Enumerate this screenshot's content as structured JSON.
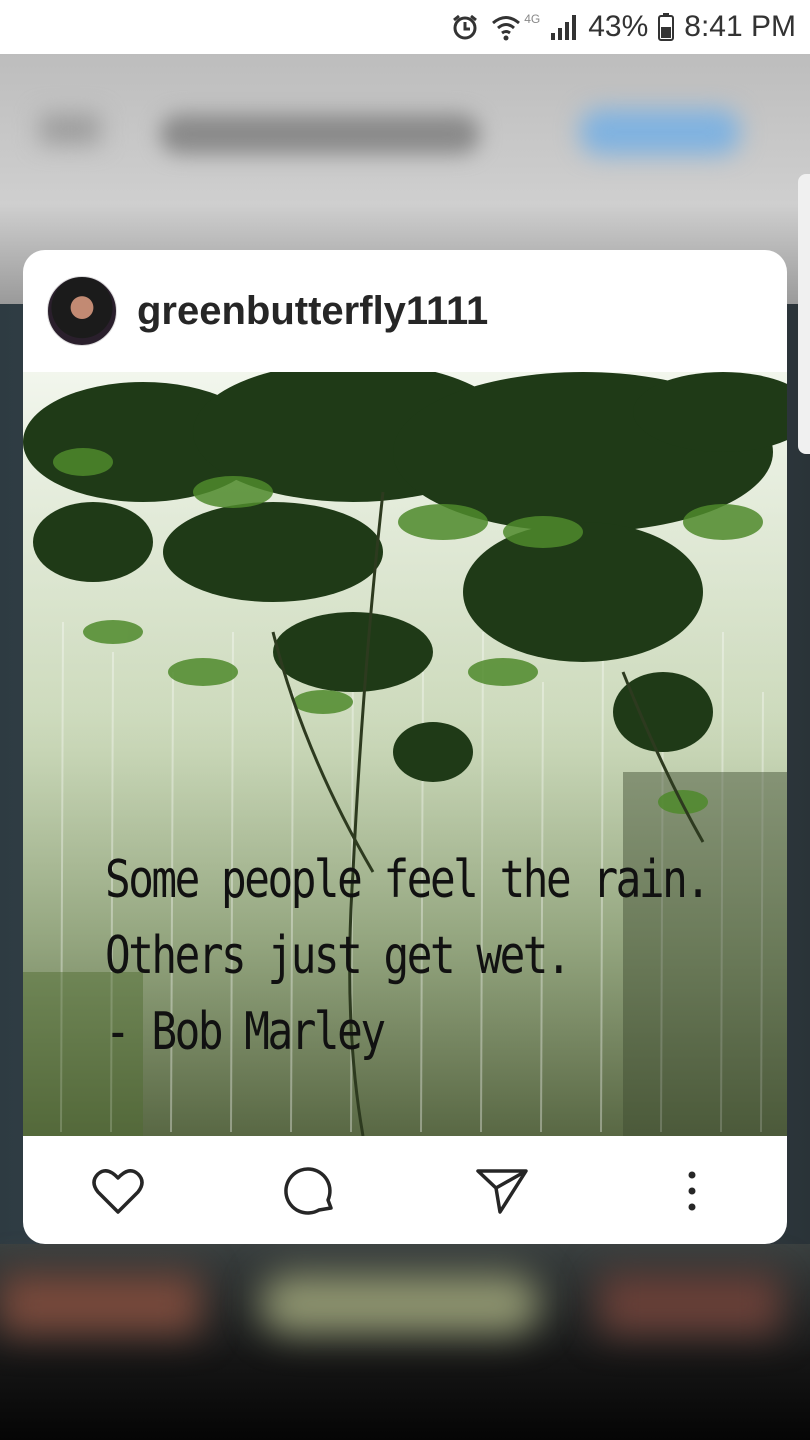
{
  "status_bar": {
    "network": "4G",
    "battery_percent": "43%",
    "time": "8:41 PM",
    "icons": [
      "alarm-icon",
      "wifi-icon",
      "signal-icon",
      "battery-icon"
    ]
  },
  "post": {
    "username": "greenbutterfly1111",
    "image_quote_lines": [
      "Some people feel the rain.",
      "Others just get wet.",
      "- Bob Marley"
    ],
    "actions": [
      "like-icon",
      "comment-icon",
      "share-icon",
      "more-options-icon"
    ]
  },
  "colors": {
    "card_background": "#ffffff",
    "username_text": "#262626",
    "icon_stroke": "#262626"
  }
}
